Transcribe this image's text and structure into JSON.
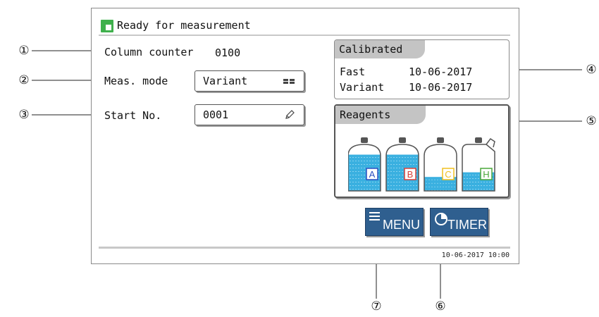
{
  "status": {
    "text": "Ready for measurement",
    "icon": "ready-square-icon",
    "icon_color": "#3fb04c"
  },
  "fields": {
    "column_counter": {
      "label": "Column counter",
      "value": "0100"
    },
    "meas_mode": {
      "label": "Meas. mode",
      "value": "Variant",
      "icon": "grid-icon"
    },
    "start_no": {
      "label": "Start No.",
      "value": "0001",
      "icon": "pencil-icon"
    }
  },
  "calibrated": {
    "title": "Calibrated",
    "rows": [
      {
        "name": "Fast",
        "date": "10-06-2017"
      },
      {
        "name": "Variant",
        "date": "10-06-2017"
      }
    ]
  },
  "reagents": {
    "title": "Reagents",
    "bottles": [
      {
        "letter": "A",
        "level": 0.78,
        "color": "#2a4fbf",
        "shape": "round"
      },
      {
        "letter": "B",
        "level": 0.78,
        "color": "#d8403a",
        "shape": "round"
      },
      {
        "letter": "C",
        "level": 0.3,
        "color": "#f0c020",
        "shape": "round"
      },
      {
        "letter": "H",
        "level": 0.4,
        "color": "#4aa83a",
        "shape": "canister"
      }
    ],
    "liquid_color": "#3ab0e0"
  },
  "buttons": {
    "menu": {
      "label": "MENU",
      "icon": "hamburger-icon"
    },
    "timer": {
      "label": "TIMER",
      "icon": "clock-icon"
    }
  },
  "datetime": "10-06-2017 10:00",
  "accent_color": "#2f5f8f",
  "callouts": [
    "①",
    "②",
    "③",
    "④",
    "⑤",
    "⑥",
    "⑦"
  ]
}
